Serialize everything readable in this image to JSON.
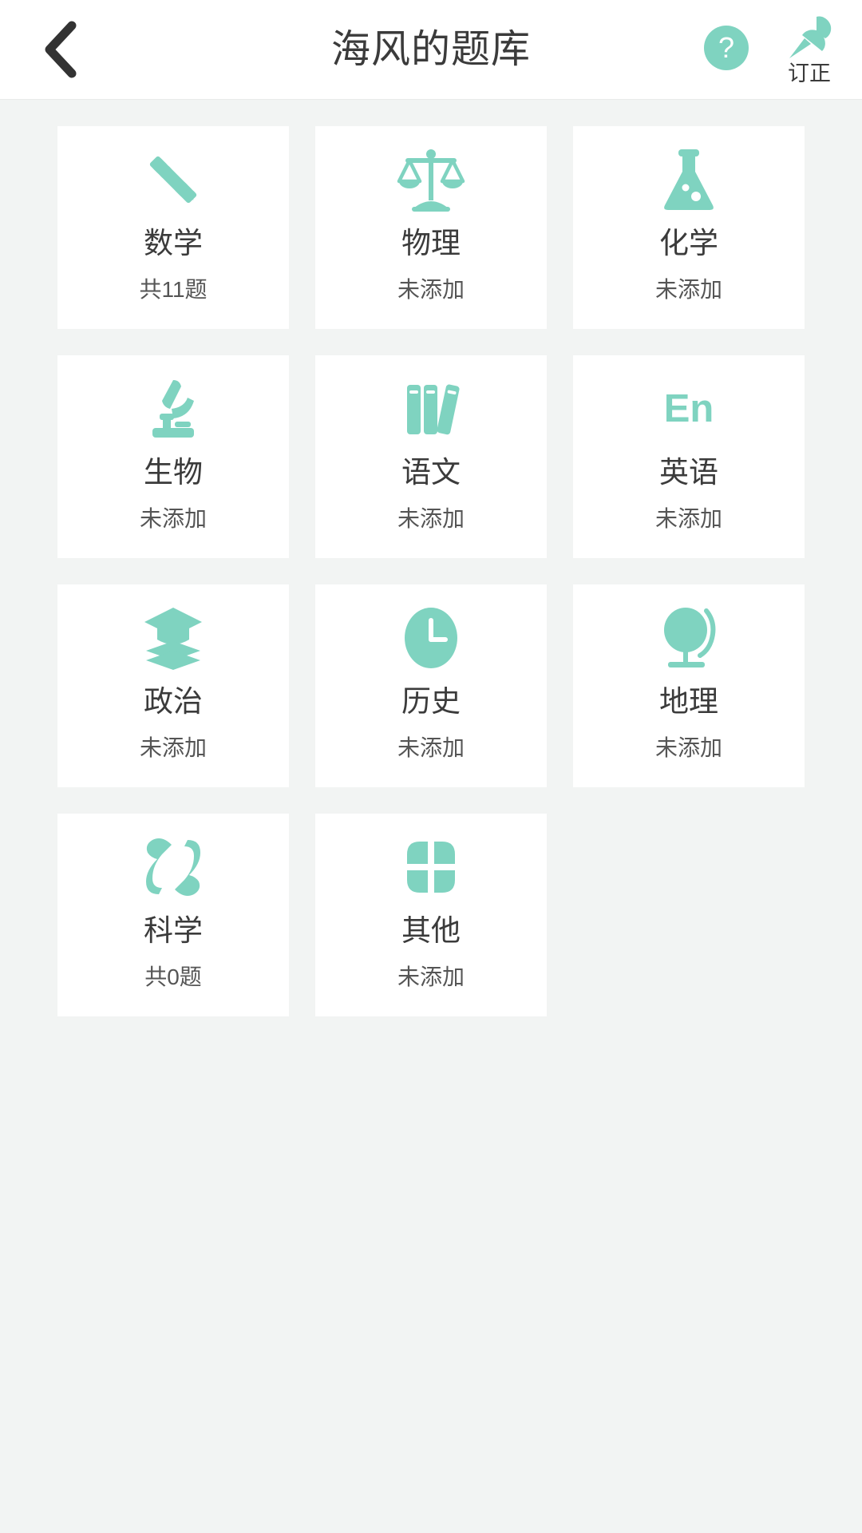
{
  "header": {
    "title": "海风的题库",
    "back_icon": "chevron-left-icon",
    "help_icon": "question-mark-icon",
    "help_label": "?",
    "pin_icon": "pin-icon",
    "pin_label": "订正"
  },
  "colors": {
    "accent": "#7fd3c0",
    "background": "#f2f4f3",
    "card": "#ffffff",
    "text_primary": "#3b3b3b",
    "text_secondary": "#555555"
  },
  "grid": {
    "cards": [
      {
        "name": "数学",
        "count": "共11题",
        "icon": "pencil-ruler-icon"
      },
      {
        "name": "物理",
        "count": "未添加",
        "icon": "balance-scale-icon"
      },
      {
        "name": "化学",
        "count": "未添加",
        "icon": "flask-icon"
      },
      {
        "name": "生物",
        "count": "未添加",
        "icon": "microscope-icon"
      },
      {
        "name": "语文",
        "count": "未添加",
        "icon": "books-icon"
      },
      {
        "name": "英语",
        "count": "未添加",
        "icon": "en-text-icon"
      },
      {
        "name": "政治",
        "count": "未添加",
        "icon": "graduation-cap-book-icon"
      },
      {
        "name": "历史",
        "count": "未添加",
        "icon": "clock-icon"
      },
      {
        "name": "地理",
        "count": "未添加",
        "icon": "globe-icon"
      },
      {
        "name": "科学",
        "count": "共0题",
        "icon": "atom-icon"
      },
      {
        "name": "其他",
        "count": "未添加",
        "icon": "clover-grid-icon"
      }
    ]
  }
}
